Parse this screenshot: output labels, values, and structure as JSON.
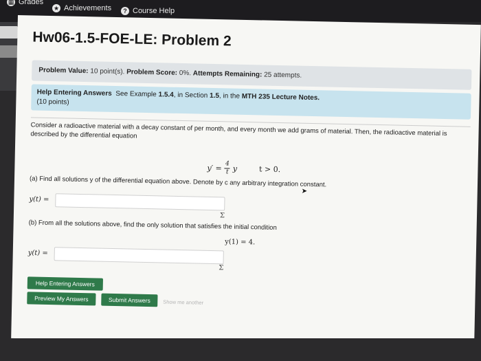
{
  "nav": {
    "grades_label": "Grades",
    "achievements_label": "Achievements",
    "course_help_label": "Course Help"
  },
  "problem": {
    "title": "Hw06-1.5-FOE-LE: Problem 2",
    "value_label": "Problem Value:",
    "value": "10 point(s).",
    "score_label": "Problem Score:",
    "score": "0%.",
    "attempts_label": "Attempts Remaining:",
    "attempts": "25 attempts.",
    "help_heading": "Help Entering Answers",
    "help_text_prefix": "See Example",
    "help_example": "1.5.4",
    "help_text_mid": ", in Section",
    "help_section": "1.5",
    "help_text_mid2": ", in the",
    "help_notes": "MTH 235 Lecture Notes.",
    "points": "(10 points)",
    "statement": "Consider a radioactive material with a decay constant of per month, and every month we add grams of material. Then, the radioactive material is described by the differential equation",
    "equation_lhs": "y′ =",
    "equation_num": "4",
    "equation_den": "t",
    "equation_rhs": "y",
    "equation_cond": "t > 0.",
    "part_a": "(a) Find all solutions y of the differential equation above. Denote by c any arbitrary integration constant.",
    "answer_a_label": "y(t) =",
    "part_b": "(b) From all the solutions above, find the only solution that satisfies the initial condition",
    "initial_condition": "y(1) = 4.",
    "answer_b_label": "y(t) =",
    "sigma": "Σ"
  },
  "buttons": {
    "help_entering": "Help Entering Answers",
    "preview": "Preview My Answers",
    "submit": "Submit Answers",
    "show_another": "Show me another"
  },
  "colors": {
    "button_green": "#2f7a4a",
    "help_bar_blue": "#c7e3ee",
    "value_bar_gray": "#dfe3e6"
  }
}
